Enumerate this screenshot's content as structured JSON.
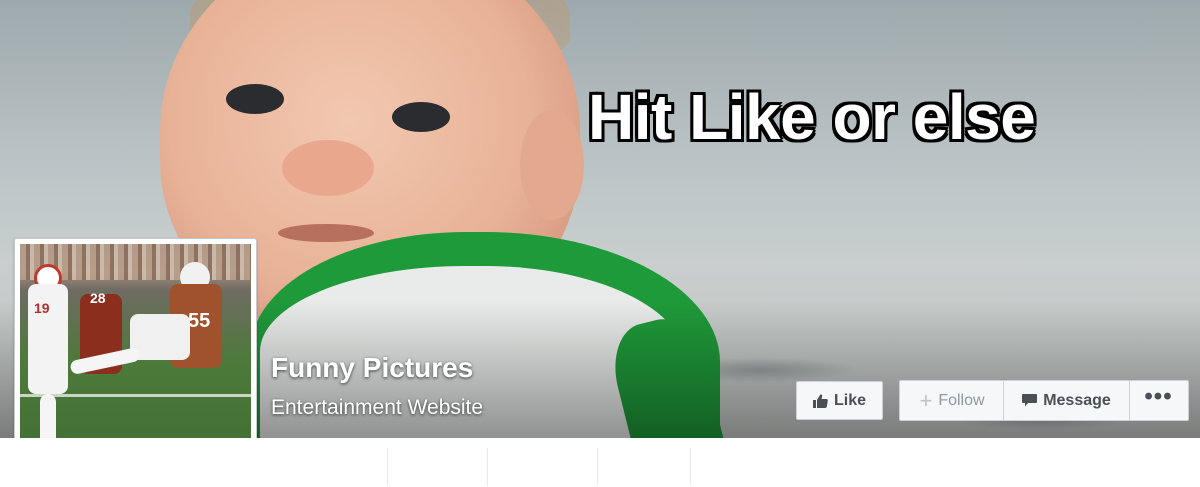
{
  "cover": {
    "meme_text": "Hit Like or else",
    "colors": {
      "shirt_green": "#1f9a3a",
      "sea_gray": "#b9c2c4"
    }
  },
  "profile": {
    "name": "Funny Pictures",
    "category": "Entertainment Website",
    "picture_numbers": [
      "55",
      "28",
      "19"
    ]
  },
  "actions": {
    "like_label": "Like",
    "follow_label": "Follow",
    "message_label": "Message",
    "more_label": "•••",
    "icons": {
      "like": "thumbs-up-icon",
      "follow": "plus-icon",
      "message": "speech-bubble-icon",
      "more": "more-dots-icon"
    }
  }
}
